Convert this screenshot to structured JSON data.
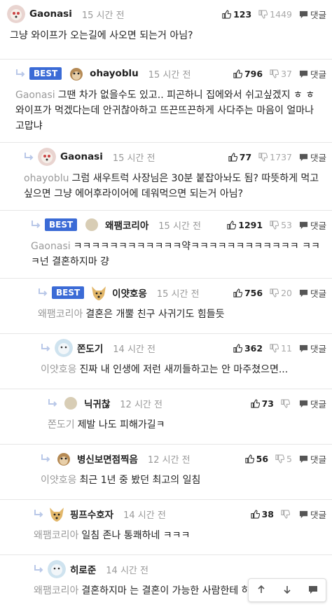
{
  "comments": [
    {
      "nick": "Gaonasi",
      "time": "15 시간 전",
      "up": "123",
      "down": "1449",
      "reply": "댓글",
      "best": "",
      "mention": "",
      "text": "그냥 와이프가 오는길에 사오면 되는거 아님?"
    },
    {
      "nick": "ohayoblu",
      "time": "15 시간 전",
      "up": "796",
      "down": "37",
      "reply": "댓글",
      "best": "BEST",
      "mention": "Gaonasi",
      "text": "그땐 차가 없을수도 있고.. 피곤하니 집에와서 쉬고싶겠지 ㅎ ㅎ 와이프가 먹겠다는데 안귀찮아하고 뜨끈뜨끈하게 사다주는 마음이 얼마나 고맙냐"
    },
    {
      "nick": "Gaonasi",
      "time": "15 시간 전",
      "up": "77",
      "down": "1737",
      "reply": "댓글",
      "best": "",
      "mention": "ohayoblu",
      "text": "그럼 새우트럭 사장님은 30분 붙잡아놔도 됨? 따뜻하게 먹고 싶으면 그냥 에어후라이어에 데워먹으면 되는거 아님?"
    },
    {
      "nick": "왜팸코리아",
      "time": "15 시간 전",
      "up": "1291",
      "down": "53",
      "reply": "댓글",
      "best": "BEST",
      "mention": "Gaonasi",
      "text": "ㅋㅋㅋㅋㅋㅋㅋㅋㅋㅋㅋㅋ약ㅋㅋㅋㅋㅋㅋㅋㅋㅋㅋㅋㅋ ㅋㅋㅋ넌 결혼하지마 걍"
    },
    {
      "nick": "이얏호응",
      "time": "15 시간 전",
      "up": "756",
      "down": "20",
      "reply": "댓글",
      "best": "BEST",
      "mention": "왜팸코리아",
      "text": "결혼은 개뿔 친구 사귀기도 힘들듯"
    },
    {
      "nick": "쫀도기",
      "time": "14 시간 전",
      "up": "362",
      "down": "11",
      "reply": "댓글",
      "best": "",
      "mention": "이얏호응",
      "text": "진짜 내 인생에 저런 새끼들하고는 안 마주쳤으면..."
    },
    {
      "nick": "닉귀찮",
      "time": "12 시간 전",
      "up": "73",
      "down": "",
      "reply": "댓글",
      "best": "",
      "mention": "쫀도기",
      "text": "제발 나도 피해가길ㅋ"
    },
    {
      "nick": "병신보면점찍음",
      "time": "12 시간 전",
      "up": "56",
      "down": "5",
      "reply": "댓글",
      "best": "",
      "mention": "이얏호응",
      "text": "최근 1년 중 봤던 최고의 일침"
    },
    {
      "nick": "핑프수호자",
      "time": "14 시간 전",
      "up": "38",
      "down": "",
      "reply": "댓글",
      "best": "",
      "mention": "왜팸코리아",
      "text": "일침 존나 통쾌하네 ㅋㅋㅋ"
    },
    {
      "nick": "히로준",
      "time": "14 시간 전",
      "up": "",
      "down": "",
      "reply": "",
      "best": "",
      "mention": "왜팸코리아",
      "text": "결혼하지마 는 결혼이 가능한 사람한테 하는말이고"
    }
  ],
  "floating_bar": {
    "up_icon": "arrow-up-icon",
    "down_icon": "arrow-down-icon",
    "comment_icon": "speech-bubble-icon"
  },
  "colors": {
    "best_badge": "#3b6bd6",
    "mention": "#9a9a9a",
    "time": "#999999"
  }
}
